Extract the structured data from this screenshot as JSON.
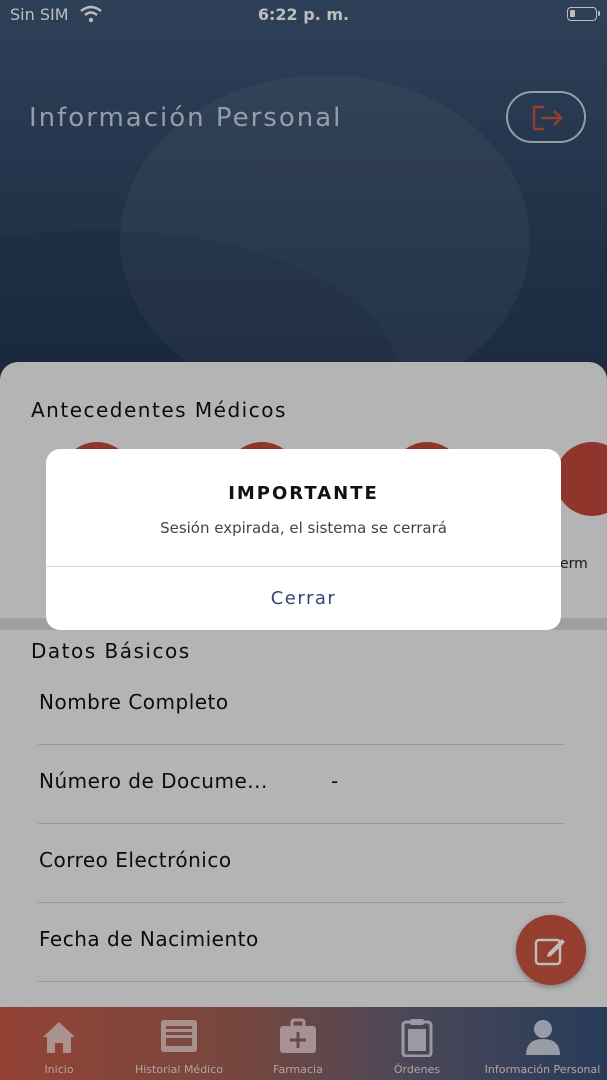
{
  "status_bar": {
    "carrier": "Sin SIM",
    "time": "6:22 p. m.",
    "battery_level": 0.15
  },
  "header": {
    "title": "Información Personal",
    "logout_icon": "logout-icon"
  },
  "antecedentes": {
    "title": "Antecedentes Médicos",
    "items": [
      {
        "label": ""
      },
      {
        "label": ""
      },
      {
        "label": ""
      },
      {
        "label": "erm"
      }
    ],
    "item_color": "#c1483a"
  },
  "datos_basicos": {
    "title": "Datos Básicos",
    "fields": [
      {
        "label": "Nombre Completo",
        "value": ""
      },
      {
        "label": "Número de Docume...",
        "value": "-"
      },
      {
        "label": "Correo Electrónico",
        "value": ""
      },
      {
        "label": "Fecha de Nacimiento",
        "value": ""
      }
    ]
  },
  "fab": {
    "icon": "edit-icon",
    "color": "#c9533f"
  },
  "tabbar": {
    "tabs": [
      {
        "label": "Inicio",
        "icon": "home-icon"
      },
      {
        "label": "Historial Médico",
        "icon": "inbox-icon"
      },
      {
        "label": "Farmacia",
        "icon": "medkit-icon"
      },
      {
        "label": "Órdenes",
        "icon": "clipboard-icon"
      },
      {
        "label": "Información Personal",
        "icon": "user-icon"
      }
    ]
  },
  "dialog": {
    "title": "IMPORTANTE",
    "message": "Sesión expirada, el sistema se cerrará",
    "button_label": "Cerrar"
  },
  "colors": {
    "header": "#2e4564",
    "accent": "#c1483a",
    "dialog_button": "#2c4a72"
  }
}
